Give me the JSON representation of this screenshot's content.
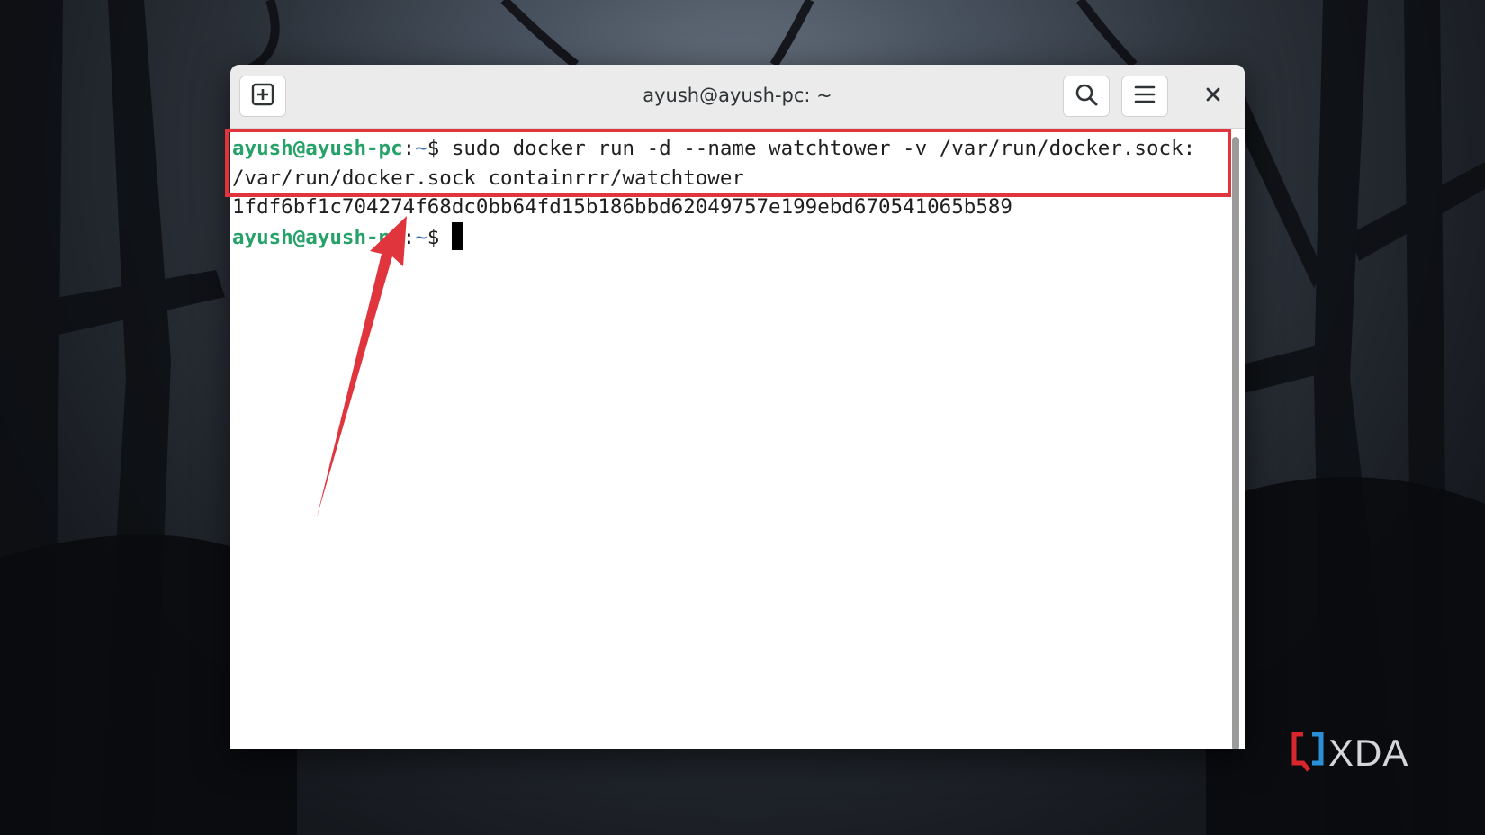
{
  "window": {
    "title": "ayush@ayush-pc: ~"
  },
  "headerbar": {
    "new_tab_icon": "new-tab-icon",
    "search_icon": "search-icon",
    "menu_icon": "hamburger-menu-icon",
    "close_icon": "close-icon"
  },
  "terminal": {
    "lines": [
      {
        "user": "ayush@ayush-pc",
        "sep": ":",
        "path": "~",
        "dollar": "$ ",
        "command": "sudo docker run -d --name watchtower -v /var/run/docker.sock:"
      },
      {
        "text": "/var/run/docker.sock containrrr/watchtower"
      },
      {
        "text": "1fdf6bf1c704274f68dc0bb64fd15b186bbd62049757e199ebd670541065b589"
      },
      {
        "user": "ayush@ayush-pc",
        "sep": ":",
        "path": "~",
        "dollar": "$ ",
        "command": ""
      }
    ]
  },
  "annotation": {
    "highlight_color": "#e0353d"
  },
  "watermark": {
    "text": "XDA",
    "logo_icon": "xda-logo-icon"
  },
  "colors": {
    "prompt_user": "#26a269",
    "prompt_path": "#3a6fb3",
    "terminal_bg": "#ffffff",
    "headerbar_bg": "#ebebeb"
  }
}
